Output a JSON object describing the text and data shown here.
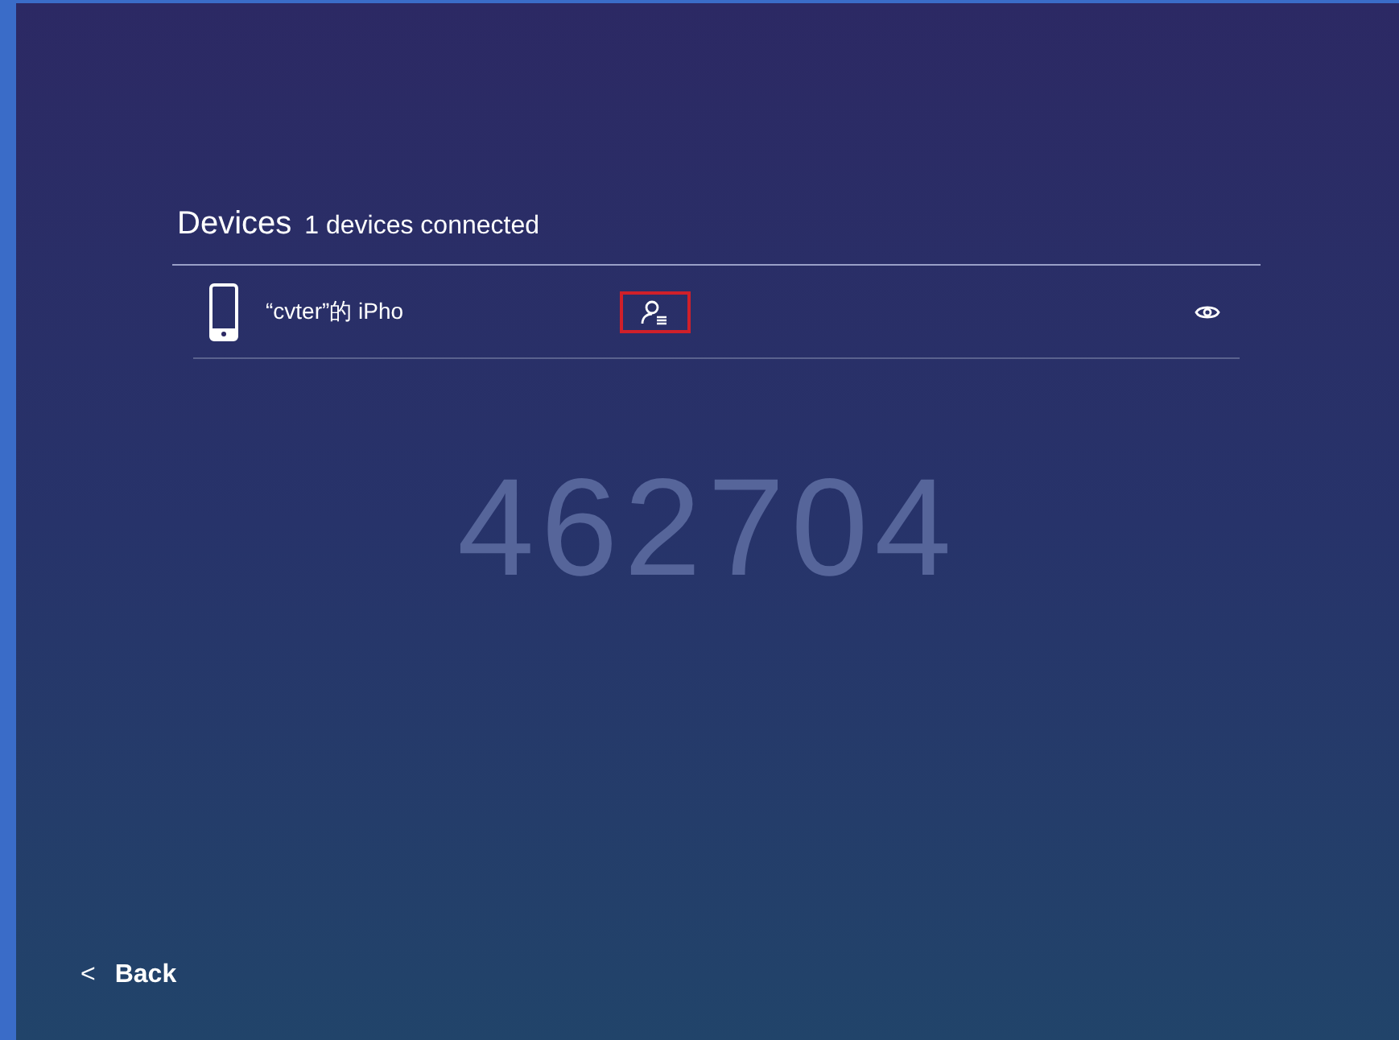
{
  "header": {
    "title": "Devices",
    "subtitle": "1 devices connected"
  },
  "devices": [
    {
      "name": "“cvter”的 iPho",
      "highlighted": true
    }
  ],
  "code": "462704",
  "back": {
    "icon": "<",
    "label": "Back"
  }
}
